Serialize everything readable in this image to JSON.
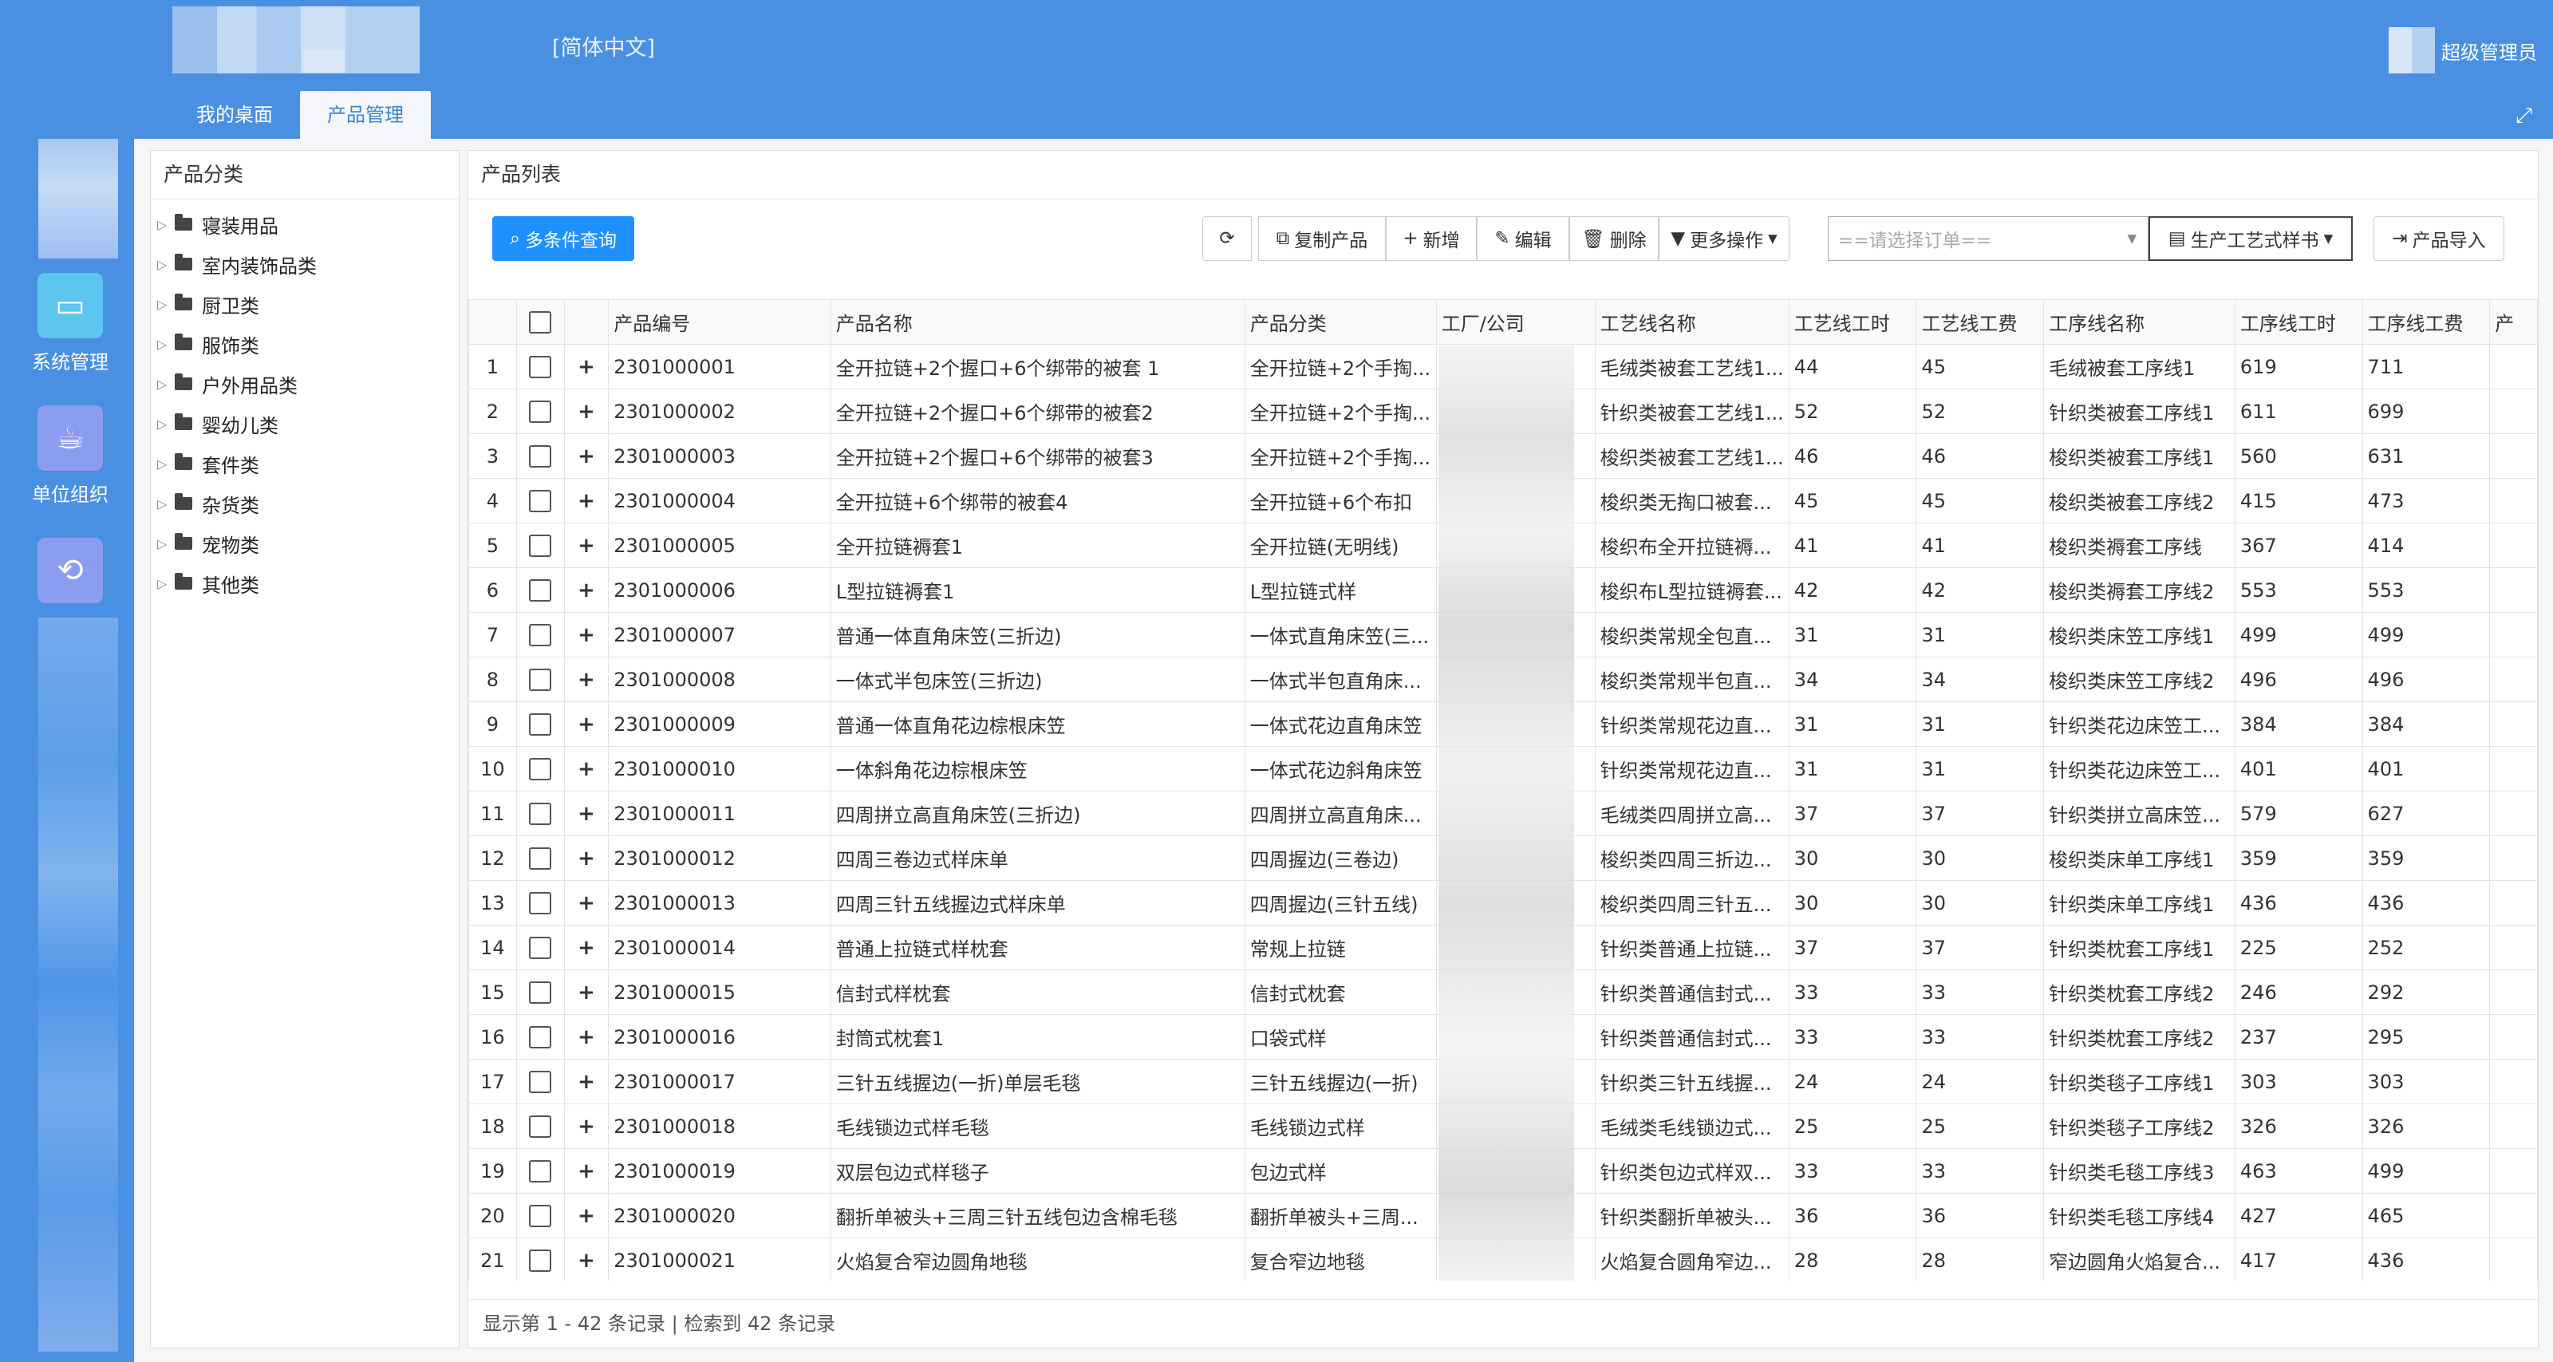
{
  "header": {
    "lang": "[简体中文]",
    "user": "超级管理员"
  },
  "tabs": [
    "我的桌面",
    "产品管理"
  ],
  "nav": [
    {
      "label": "系统管理",
      "icon": "monitor-icon"
    },
    {
      "label": "单位组织",
      "icon": "cup-icon"
    },
    {
      "label": "",
      "icon": "spin-icon"
    }
  ],
  "sidebar": {
    "title": "产品分类",
    "items": [
      "寝装用品",
      "室内装饰品类",
      "厨卫类",
      "服饰类",
      "户外用品类",
      "婴幼儿类",
      "套件类",
      "杂货类",
      "宠物类",
      "其他类"
    ]
  },
  "product": {
    "title": "产品列表",
    "toolbar": {
      "search": "多条件查询",
      "refresh": "⟳",
      "copy": "复制产品",
      "add": "新增",
      "edit": "编辑",
      "delete": "删除",
      "more": "更多操作",
      "order_placeholder": "==请选择订单==",
      "process": "生产工艺式样书",
      "import": "产品导入"
    },
    "columns": [
      "产品编号",
      "产品名称",
      "产品分类",
      "工厂/公司",
      "工艺线名称",
      "工艺线工时",
      "工艺线工费",
      "工序线名称",
      "工序线工时",
      "工序线工费",
      "产"
    ],
    "rows": [
      [
        "1",
        "2301000001",
        "全开拉链+2个握口+6个绑带的被套 1",
        "全开拉链+2个手掏...",
        "毛绒类被套工艺线1...",
        "44",
        "45",
        "毛绒被套工序线1",
        "619",
        "711"
      ],
      [
        "2",
        "2301000002",
        "全开拉链+2个握口+6个绑带的被套2",
        "全开拉链+2个手掏...",
        "针织类被套工艺线1...",
        "52",
        "52",
        "针织类被套工序线1",
        "611",
        "699"
      ],
      [
        "3",
        "2301000003",
        "全开拉链+2个握口+6个绑带的被套3",
        "全开拉链+2个手掏...",
        "梭织类被套工艺线1...",
        "46",
        "46",
        "梭织类被套工序线1",
        "560",
        "631"
      ],
      [
        "4",
        "2301000004",
        "全开拉链+6个绑带的被套4",
        "全开拉链+6个布扣",
        "梭织类无掏口被套...",
        "45",
        "45",
        "梭织类被套工序线2",
        "415",
        "473"
      ],
      [
        "5",
        "2301000005",
        "全开拉链褥套1",
        "全开拉链(无明线)",
        "梭织布全开拉链褥...",
        "41",
        "41",
        "梭织类褥套工序线",
        "367",
        "414"
      ],
      [
        "6",
        "2301000006",
        "L型拉链褥套1",
        "L型拉链式样",
        "梭织布L型拉链褥套...",
        "42",
        "42",
        "梭织类褥套工序线2",
        "553",
        "553"
      ],
      [
        "7",
        "2301000007",
        "普通一体直角床笠(三折边)",
        "一体式直角床笠(三...",
        "梭织类常规全包直...",
        "31",
        "31",
        "梭织类床笠工序线1",
        "499",
        "499"
      ],
      [
        "8",
        "2301000008",
        "一体式半包床笠(三折边)",
        "一体式半包直角床...",
        "梭织类常规半包直...",
        "34",
        "34",
        "梭织类床笠工序线2",
        "496",
        "496"
      ],
      [
        "9",
        "2301000009",
        "普通一体直角花边棕根床笠",
        "一体式花边直角床笠",
        "针织类常规花边直...",
        "31",
        "31",
        "针织类花边床笠工...",
        "384",
        "384"
      ],
      [
        "10",
        "2301000010",
        "一体斜角花边棕根床笠",
        "一体式花边斜角床笠",
        "针织类常规花边直...",
        "31",
        "31",
        "针织类花边床笠工...",
        "401",
        "401"
      ],
      [
        "11",
        "2301000011",
        "四周拼立高直角床笠(三折边)",
        "四周拼立高直角床...",
        "毛绒类四周拼立高...",
        "37",
        "37",
        "针织类拼立高床笠...",
        "579",
        "627"
      ],
      [
        "12",
        "2301000012",
        "四周三卷边式样床单",
        "四周握边(三卷边)",
        "梭织类四周三折边...",
        "30",
        "30",
        "梭织类床单工序线1",
        "359",
        "359"
      ],
      [
        "13",
        "2301000013",
        "四周三针五线握边式样床单",
        "四周握边(三针五线)",
        "梭织类四周三针五...",
        "30",
        "30",
        "针织类床单工序线1",
        "436",
        "436"
      ],
      [
        "14",
        "2301000014",
        "普通上拉链式样枕套",
        "常规上拉链",
        "针织类普通上拉链...",
        "37",
        "37",
        "针织类枕套工序线1",
        "225",
        "252"
      ],
      [
        "15",
        "2301000015",
        "信封式样枕套",
        "信封式枕套",
        "针织类普通信封式...",
        "33",
        "33",
        "针织类枕套工序线2",
        "246",
        "292"
      ],
      [
        "16",
        "2301000016",
        "封筒式枕套1",
        "口袋式样",
        "针织类普通信封式...",
        "33",
        "33",
        "针织类枕套工序线2",
        "237",
        "295"
      ],
      [
        "17",
        "2301000017",
        "三针五线握边(一折)单层毛毯",
        "三针五线握边(一折)",
        "针织类三针五线握...",
        "24",
        "24",
        "针织类毯子工序线1",
        "303",
        "303"
      ],
      [
        "18",
        "2301000018",
        "毛线锁边式样毛毯",
        "毛线锁边式样",
        "毛绒类毛线锁边式...",
        "25",
        "25",
        "针织类毯子工序线2",
        "326",
        "326"
      ],
      [
        "19",
        "2301000019",
        "双层包边式样毯子",
        "包边式样",
        "针织类包边式样双...",
        "33",
        "33",
        "针织类毛毯工序线3",
        "463",
        "499"
      ],
      [
        "20",
        "2301000020",
        "翻折单被头+三周三针五线包边含棉毛毯",
        "翻折单被头+三周...",
        "针织类翻折单被头...",
        "36",
        "36",
        "针织类毛毯工序线4",
        "427",
        "465"
      ],
      [
        "21",
        "2301000021",
        "火焰复合窄边圆角地毯",
        "复合窄边地毯",
        "火焰复合圆角窄边...",
        "28",
        "28",
        "窄边圆角火焰复合...",
        "417",
        "436"
      ]
    ],
    "footer": "显示第 1 - 42 条记录 | 检索到 42 条记录"
  }
}
